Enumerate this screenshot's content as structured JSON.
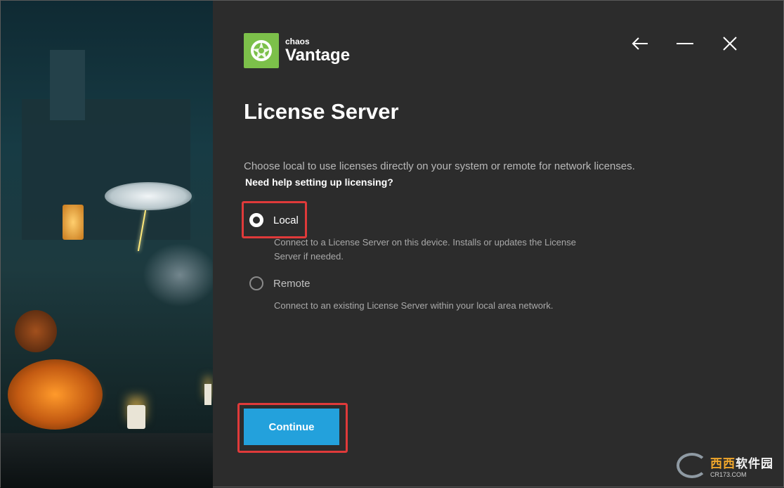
{
  "brand": {
    "small": "chaos",
    "name": "Vantage",
    "accent": "#7cc04a"
  },
  "window_controls": {
    "back": "back-arrow-icon",
    "minimize": "minimize-icon",
    "close": "close-icon"
  },
  "page": {
    "title": "License Server",
    "description": "Choose local to use licenses directly on your system or remote for network licenses.",
    "help_link": "Need help setting up licensing?"
  },
  "options": [
    {
      "label": "Local",
      "selected": true,
      "description": "Connect to a License Server on this device. Installs or updates the License Server if needed."
    },
    {
      "label": "Remote",
      "selected": false,
      "description": "Connect to an existing License Server within your local area network."
    }
  ],
  "actions": {
    "continue_label": "Continue",
    "button_color": "#23a1dc",
    "highlight_color": "#e03a3a"
  },
  "watermark": {
    "cn_hot": "西西",
    "cn_rest": "软件园",
    "url": "CR173.COM"
  }
}
